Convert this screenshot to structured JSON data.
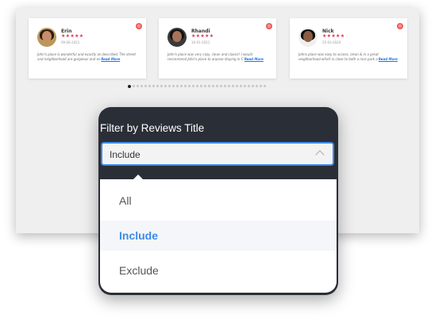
{
  "reviews": [
    {
      "name": "Erin",
      "stars": "★★★★★",
      "date": "09-06-2021",
      "text": "John's place is wonderful and exactly as described. The street and neighborhood are gorgeous and so",
      "read_more": "Read More"
    },
    {
      "name": "Rhandi",
      "stars": "★★★★★",
      "date": "10-01-2021",
      "text": "John's place was very cozy, clean and classic! I would recommend John's place to anyone staying in C",
      "read_more": "Read More"
    },
    {
      "name": "Nick",
      "stars": "★★★★★",
      "date": "25-03-2020",
      "text": "Johns place was easy to access, clean & in a great neighborhood which is close to both a nice park a",
      "read_more": "Read More"
    }
  ],
  "badge_glyph": "◎",
  "pagination": {
    "total": 35,
    "active": 0
  },
  "filter": {
    "title": "Filter by Reviews Title",
    "selected": "Include",
    "options": [
      "All",
      "Include",
      "Exclude"
    ]
  },
  "colors": {
    "accent": "#3d8bea",
    "stars": "#e6334f",
    "panel": "#2a2e36"
  }
}
